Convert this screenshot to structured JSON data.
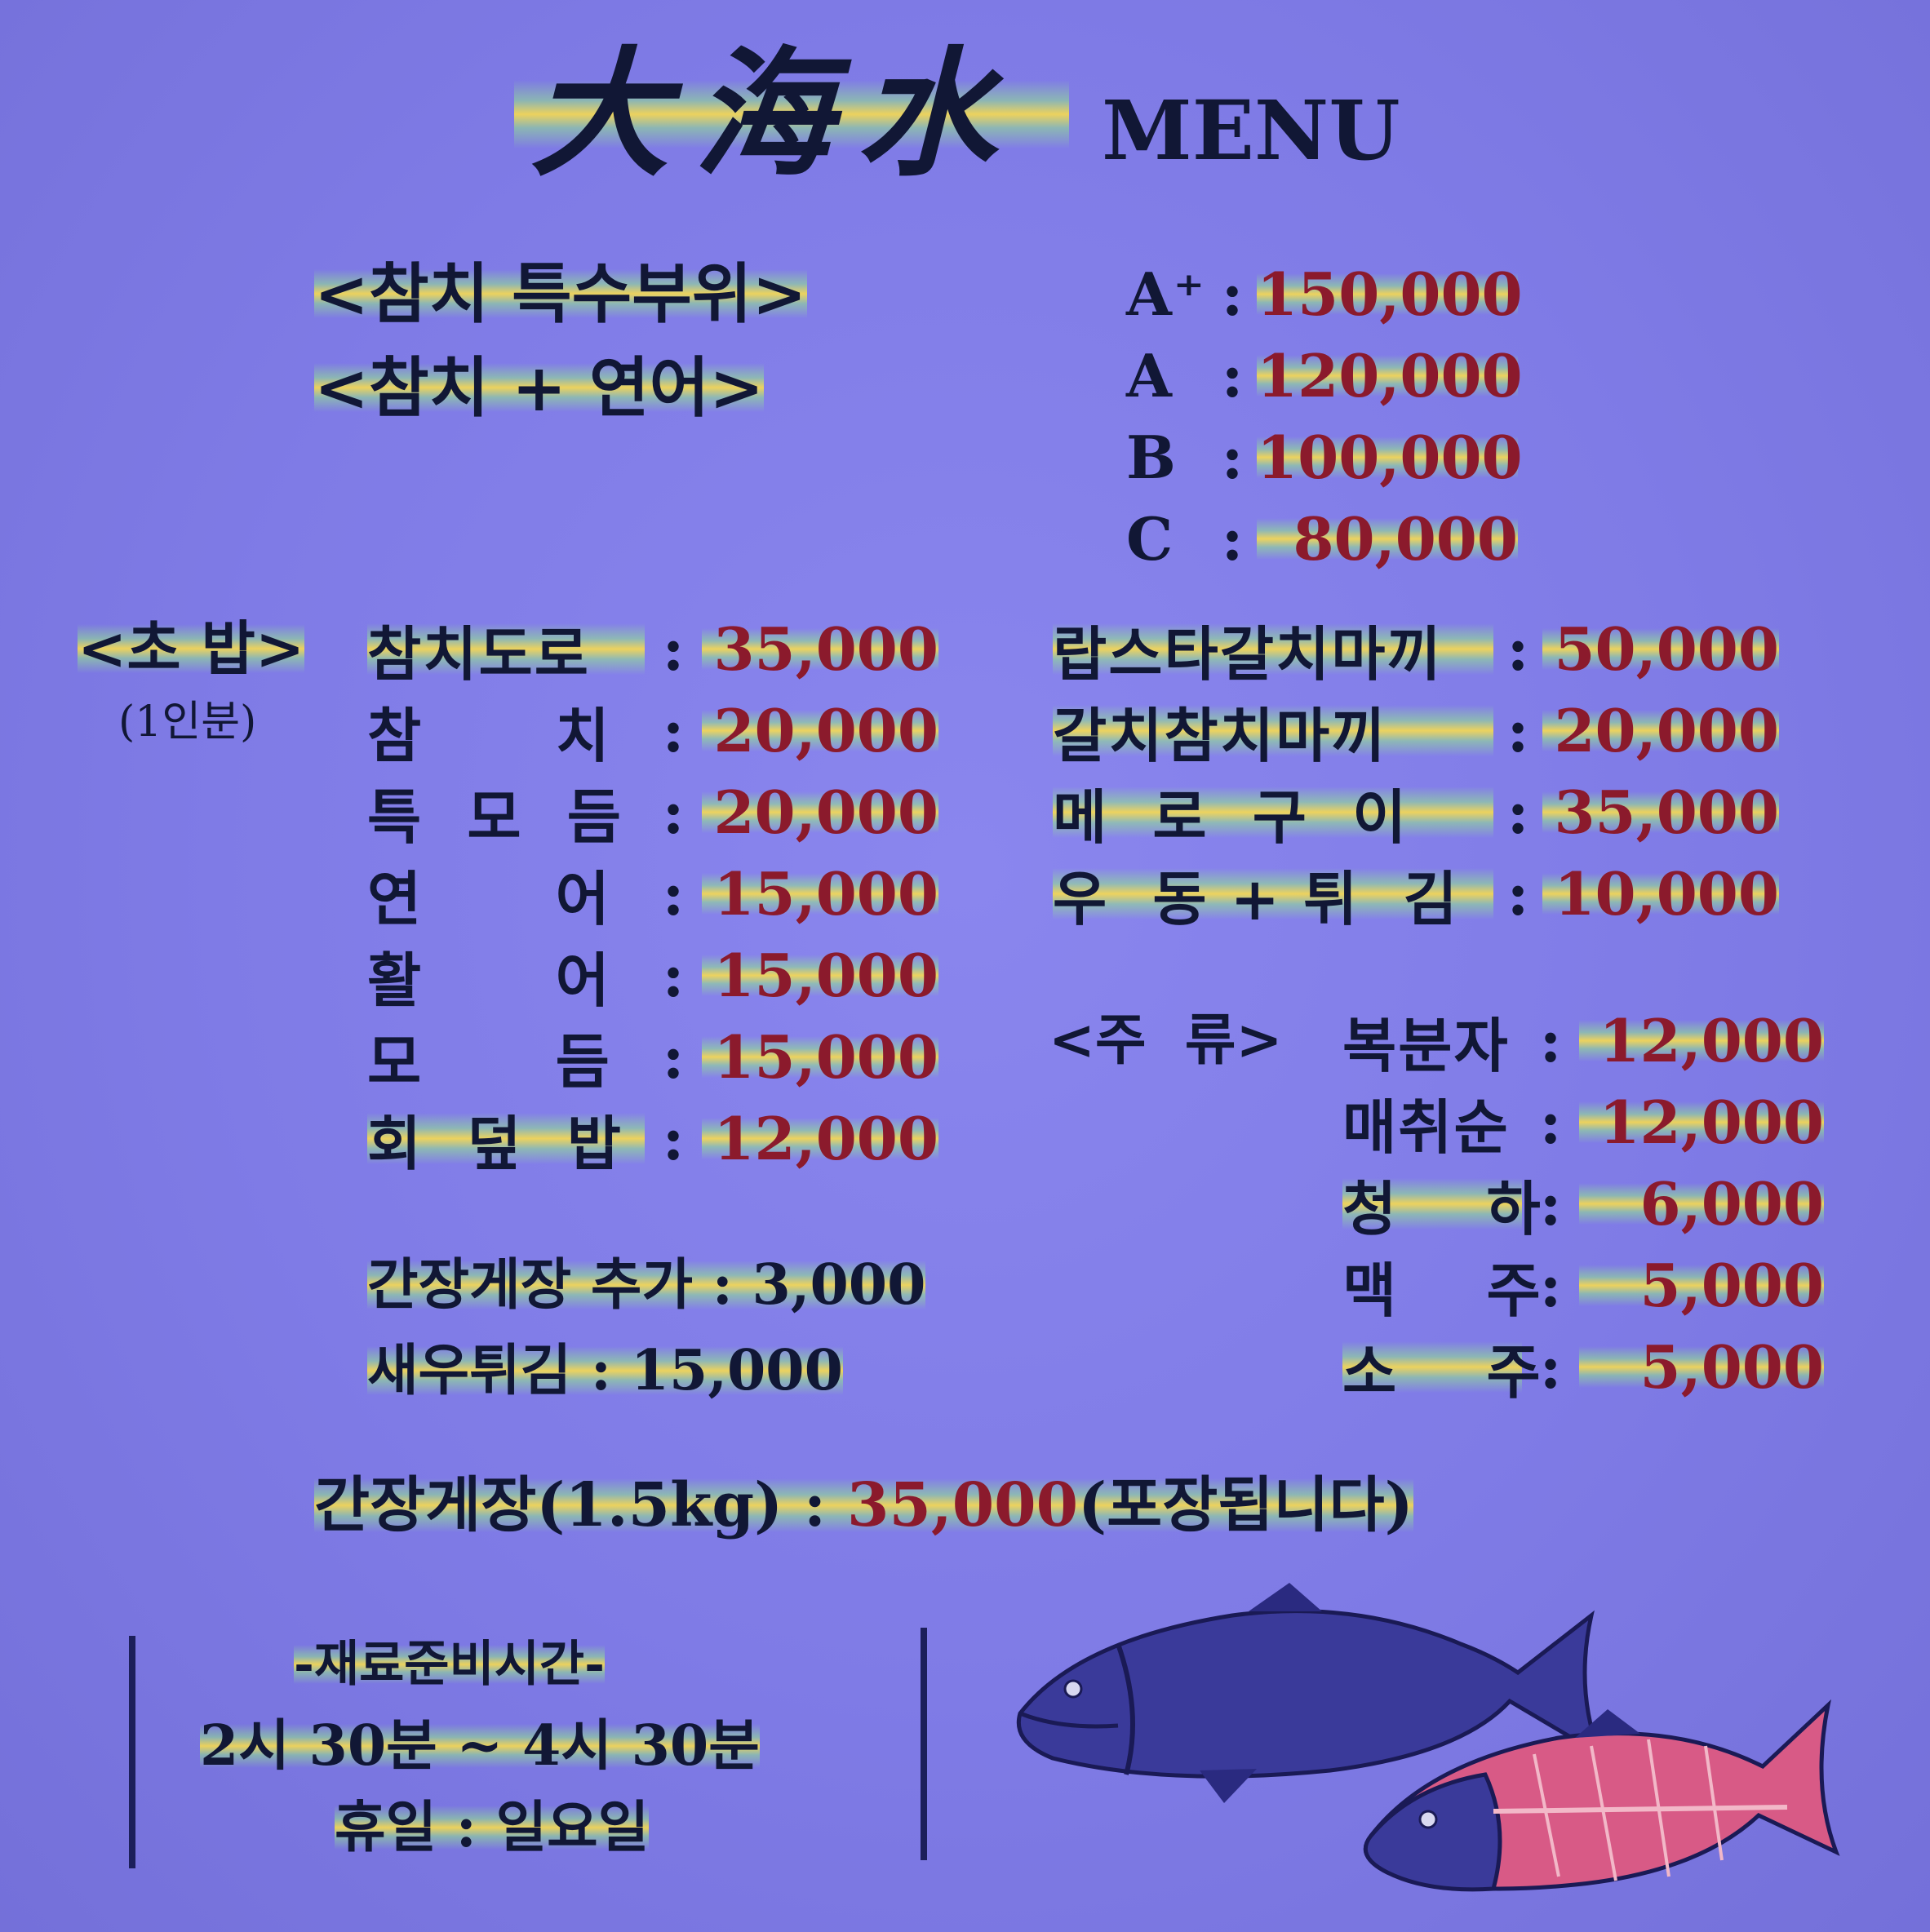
{
  "header": {
    "logo": "大海水",
    "title": "MENU"
  },
  "special": {
    "items": [
      "<참치 특수부위>",
      "<참치 + 연어>"
    ],
    "grades": [
      {
        "grade": "A⁺",
        "price": "150,000"
      },
      {
        "grade": "A",
        "price": "120,000"
      },
      {
        "grade": "B",
        "price": "100,000"
      },
      {
        "grade": "C",
        "price": "80,000"
      }
    ]
  },
  "sushi": {
    "heading": "<초  밥>",
    "sub": "(1인분)",
    "items": [
      {
        "name": "참치도로",
        "price": "35,000"
      },
      {
        "name": "참      치",
        "price": "20,000"
      },
      {
        "name": "특  모  듬",
        "price": "20,000"
      },
      {
        "name": "연      어",
        "price": "15,000"
      },
      {
        "name": "활      어",
        "price": "15,000"
      },
      {
        "name": "모      듬",
        "price": "15,000"
      },
      {
        "name": "회  덮  밥",
        "price": "12,000"
      }
    ]
  },
  "rolls": {
    "items": [
      {
        "name": "랍스타갈치마끼",
        "price": "50,000"
      },
      {
        "name": "갈치참치마끼",
        "price": "20,000"
      },
      {
        "name": "메  로  구  이",
        "price": "35,000"
      },
      {
        "name": "우  동 + 튀  김",
        "price": "10,000"
      }
    ]
  },
  "extras": [
    {
      "text": "간장게장 추가 : 3,000"
    },
    {
      "text": "새우튀김 : 15,000"
    }
  ],
  "drinks": {
    "heading": "<주  류>",
    "items": [
      {
        "name": "복분자",
        "price": "12,000"
      },
      {
        "name": "매취순",
        "price": "12,000"
      },
      {
        "name": "청    하",
        "price": "6,000"
      },
      {
        "name": "맥    주",
        "price": "5,000"
      },
      {
        "name": "소    주",
        "price": "5,000"
      }
    ]
  },
  "takeout": {
    "label": "간장게장(1.5kg) : ",
    "price": "35,000",
    "note": "(포장됩니다)"
  },
  "hours": {
    "title": "-재료준비시간-",
    "time": "2시 30분 ~ 4시 30분",
    "closed": "휴일 : 일요일"
  },
  "colors": {
    "background": "#7f7be6",
    "ink": "#111735",
    "price": "#8b1a2c"
  }
}
